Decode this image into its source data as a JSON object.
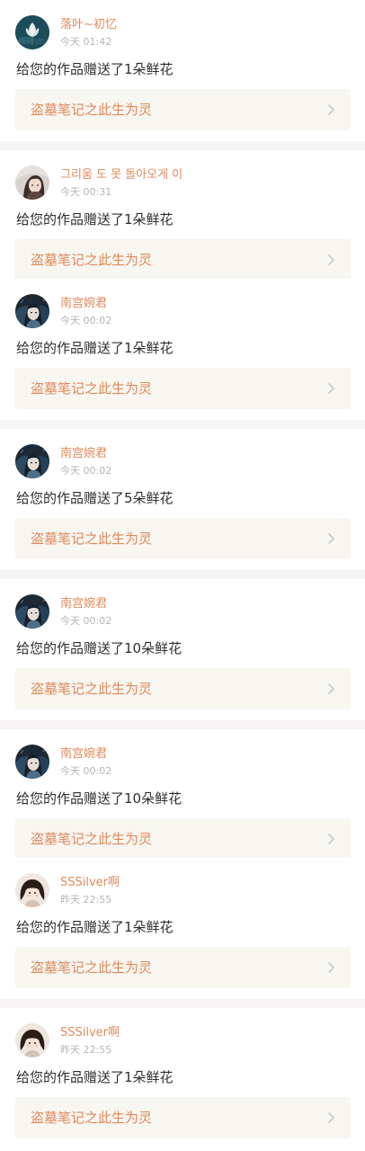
{
  "notifications": [
    {
      "username": "落叶~初忆",
      "time": "今天 01:42",
      "message": "给您的作品赠送了1朵鲜花",
      "work_title": "盗墓笔记之此生为灵",
      "avatar": "lotus-avatar-icon"
    },
    {
      "username": "그리움 도 못 돌아오게 이",
      "time": "今天 00:31",
      "message": "给您的作品赠送了1朵鲜花",
      "work_title": "盗墓笔记之此生为灵",
      "avatar": "girl-portrait-avatar-icon"
    },
    {
      "username": "南宫婉君",
      "time": "今天 00:02",
      "message": "给您的作品赠送了1朵鲜花",
      "work_title": "盗墓笔记之此生为灵",
      "avatar": "anime-character-avatar-icon"
    },
    {
      "username": "南宫婉君",
      "time": "今天 00:02",
      "message": "给您的作品赠送了5朵鲜花",
      "work_title": "盗墓笔记之此生为灵",
      "avatar": "anime-character-avatar-icon"
    },
    {
      "username": "南宫婉君",
      "time": "今天 00:02",
      "message": "给您的作品赠送了10朵鲜花",
      "work_title": "盗墓笔记之此生为灵",
      "avatar": "anime-character-avatar-icon"
    },
    {
      "username": "南宫婉君",
      "time": "今天 00:02",
      "message": "给您的作品赠送了10朵鲜花",
      "work_title": "盗墓笔记之此生为灵",
      "avatar": "anime-character-avatar-icon"
    },
    {
      "username": "SSSilver啊",
      "time": "昨天 22:55",
      "message": "给您的作品赠送了1朵鲜花",
      "work_title": "盗墓笔记之此生为灵",
      "avatar": "cartoon-girl-avatar-icon"
    },
    {
      "username": "SSSilver啊",
      "time": "昨天 22:55",
      "message": "给您的作品赠送了1朵鲜花",
      "work_title": "盗墓笔记之此生为灵",
      "avatar": "cartoon-girl-avatar-icon"
    }
  ],
  "colors": {
    "accent": "#e08a5c",
    "message_text": "#2e2e2e",
    "time_text": "#b5b5b5",
    "link_background": "#f7f6f1",
    "separator": "#f7f4f5"
  },
  "icons": {
    "chevron": "chevron-right-icon"
  }
}
